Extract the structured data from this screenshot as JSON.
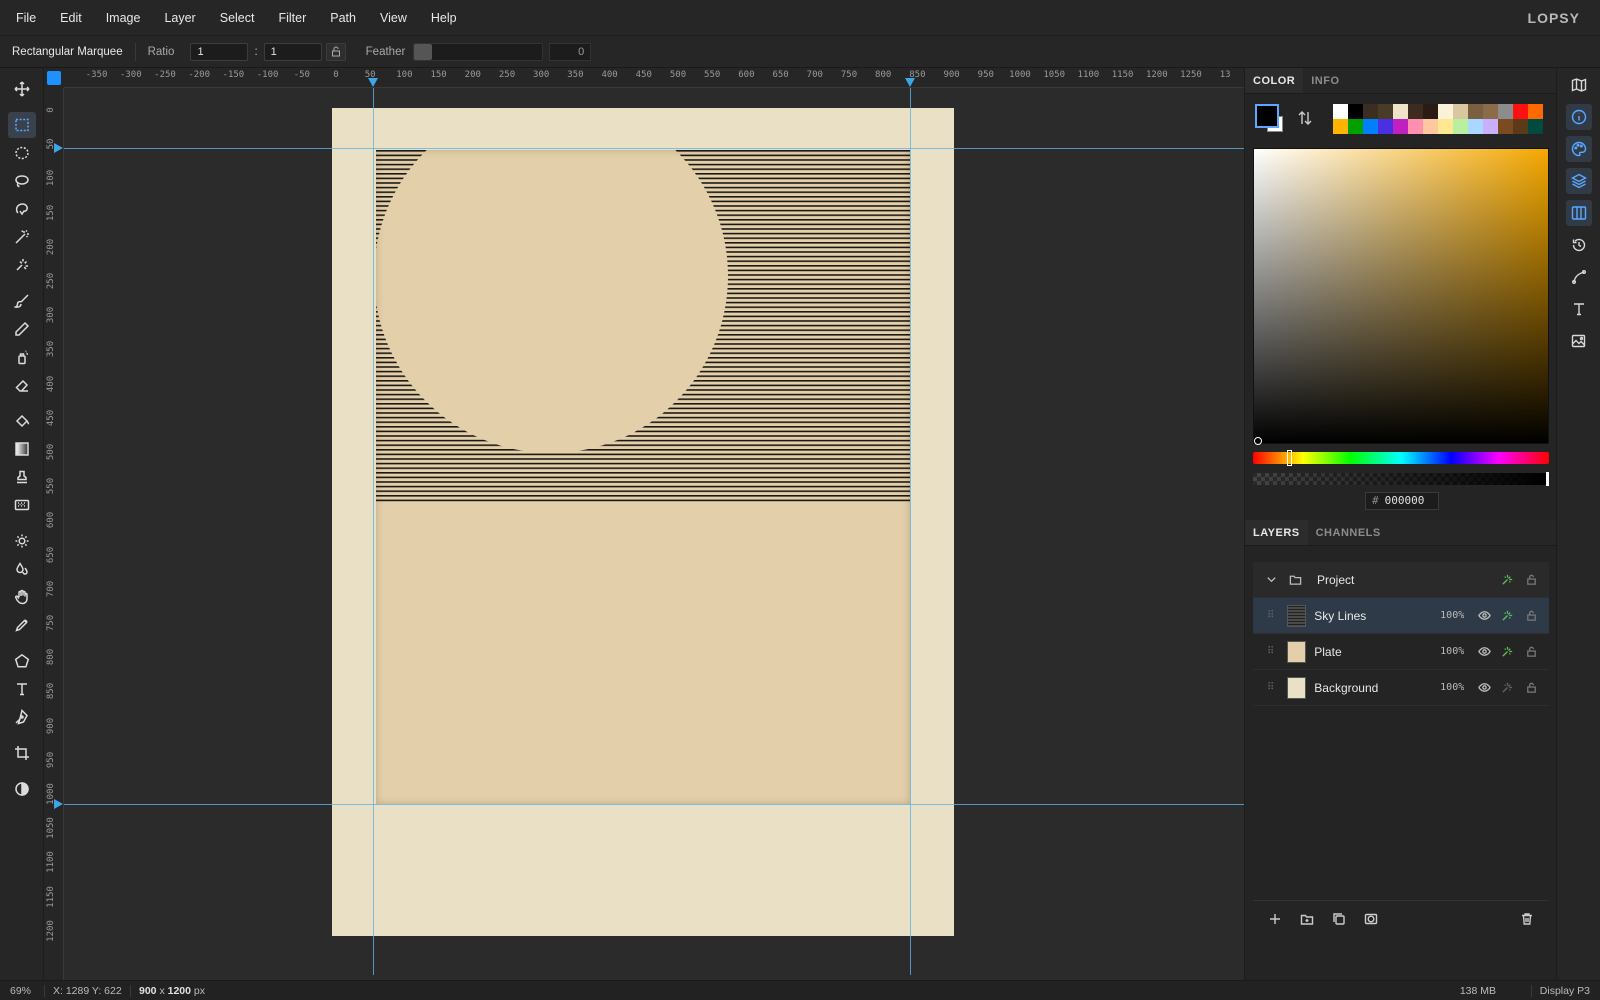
{
  "menubar": {
    "items": [
      "File",
      "Edit",
      "Image",
      "Layer",
      "Select",
      "Filter",
      "Path",
      "View",
      "Help"
    ],
    "logo": "LOPSY"
  },
  "options": {
    "tool_name": "Rectangular Marquee",
    "ratio_label": "Ratio",
    "ratio_width": "1",
    "ratio_sep": ":",
    "ratio_height": "1",
    "feather_label": "Feather",
    "feather_value": "0"
  },
  "tools": [
    {
      "name": "move-tool",
      "icon": "move-icon",
      "active": false
    },
    {
      "name": "rectangular-marquee-tool",
      "icon": "rect-marquee-icon",
      "active": true
    },
    {
      "name": "elliptical-marquee-tool",
      "icon": "ellipse-marquee-icon",
      "active": false
    },
    {
      "name": "lasso-tool",
      "icon": "lasso-icon",
      "active": false
    },
    {
      "name": "magnetic-lasso-tool",
      "icon": "magnetic-lasso-icon",
      "active": false
    },
    {
      "name": "magic-wand-tool",
      "icon": "magic-wand-icon",
      "active": false
    },
    {
      "name": "quick-selection-tool",
      "icon": "quick-select-icon",
      "active": false
    },
    {
      "name": "brush-tool",
      "icon": "brush-icon",
      "active": false
    },
    {
      "name": "pencil-tool",
      "icon": "pencil-icon",
      "active": false
    },
    {
      "name": "spray-tool",
      "icon": "spray-icon",
      "active": false
    },
    {
      "name": "eraser-tool",
      "icon": "eraser-icon",
      "active": false
    },
    {
      "name": "paint-bucket-tool",
      "icon": "bucket-icon",
      "active": false
    },
    {
      "name": "gradient-tool",
      "icon": "gradient-icon",
      "active": false
    },
    {
      "name": "clone-stamp-tool",
      "icon": "stamp-icon",
      "active": false
    },
    {
      "name": "pattern-tool",
      "icon": "pattern-icon",
      "active": false
    },
    {
      "name": "dodge-tool",
      "icon": "sun-icon",
      "active": false
    },
    {
      "name": "burn-tool",
      "icon": "drops-icon",
      "active": false
    },
    {
      "name": "hand-tool",
      "icon": "hand-icon",
      "active": false
    },
    {
      "name": "eyedropper-tool",
      "icon": "eyedropper-icon",
      "active": false
    },
    {
      "name": "shape-tool",
      "icon": "pentagon-icon",
      "active": false
    },
    {
      "name": "text-tool",
      "icon": "type-icon",
      "active": false
    },
    {
      "name": "pen-tool",
      "icon": "pen-icon",
      "active": false
    },
    {
      "name": "crop-tool",
      "icon": "crop-icon",
      "active": false
    },
    {
      "name": "quick-mask-tool",
      "icon": "contrast-icon",
      "active": false
    }
  ],
  "ruler_top": [
    "-350",
    "-300",
    "-250",
    "-200",
    "-150",
    "-100",
    "-50",
    "0",
    "50",
    "100",
    "150",
    "200",
    "250",
    "300",
    "350",
    "400",
    "450",
    "500",
    "550",
    "600",
    "650",
    "700",
    "750",
    "800",
    "850",
    "900",
    "950",
    "1000",
    "1050",
    "1100",
    "1150",
    "1200",
    "1250",
    "13"
  ],
  "ruler_left": [
    "0",
    "50",
    "100",
    "150",
    "200",
    "250",
    "300",
    "350",
    "400",
    "450",
    "500",
    "550",
    "600",
    "650",
    "700",
    "750",
    "800",
    "850",
    "900",
    "950",
    "1000",
    "1050",
    "1100",
    "1150",
    "1200"
  ],
  "color_panel": {
    "tabs": [
      "COLOR",
      "INFO"
    ],
    "foreground": "#000000",
    "background": "#ffffff",
    "hue_color": "#f4a800",
    "swatches": [
      "#ffffff",
      "#000000",
      "#3a2e22",
      "#4a3a28",
      "#efe3c8",
      "#3c2b1e",
      "#2a1c14",
      "#fbf3d8",
      "#d9c7a0",
      "#7a6040",
      "#8a6c48",
      "#8c8c8c",
      "#ff1010",
      "#ff6a00",
      "#ffb400",
      "#00a000",
      "#0080ff",
      "#4a30e0",
      "#c020c0",
      "#ff90b0",
      "#ffc8a0",
      "#ffe890",
      "#b8f0a0",
      "#a8d8ff",
      "#c8b0ff",
      "#7a4a20",
      "#5a3a18",
      "#004a40"
    ],
    "hex_label": "#",
    "hex": "000000"
  },
  "layers_panel": {
    "tabs": [
      "LAYERS",
      "CHANNELS"
    ],
    "group": {
      "name": "Project"
    },
    "layers": [
      {
        "name": "Sky Lines",
        "opacity": "100%",
        "selected": true,
        "thumb": "lines"
      },
      {
        "name": "Plate",
        "opacity": "100%",
        "selected": false,
        "thumb": "plate"
      },
      {
        "name": "Background",
        "opacity": "100%",
        "selected": false,
        "thumb": "bg"
      }
    ]
  },
  "status": {
    "zoom": "69%",
    "coords": "X: 1289 Y: 622",
    "doc_w": "900",
    "doc_x": "x",
    "doc_h": "1200",
    "doc_unit": "px",
    "memory": "138 MB",
    "profile": "Display P3"
  }
}
